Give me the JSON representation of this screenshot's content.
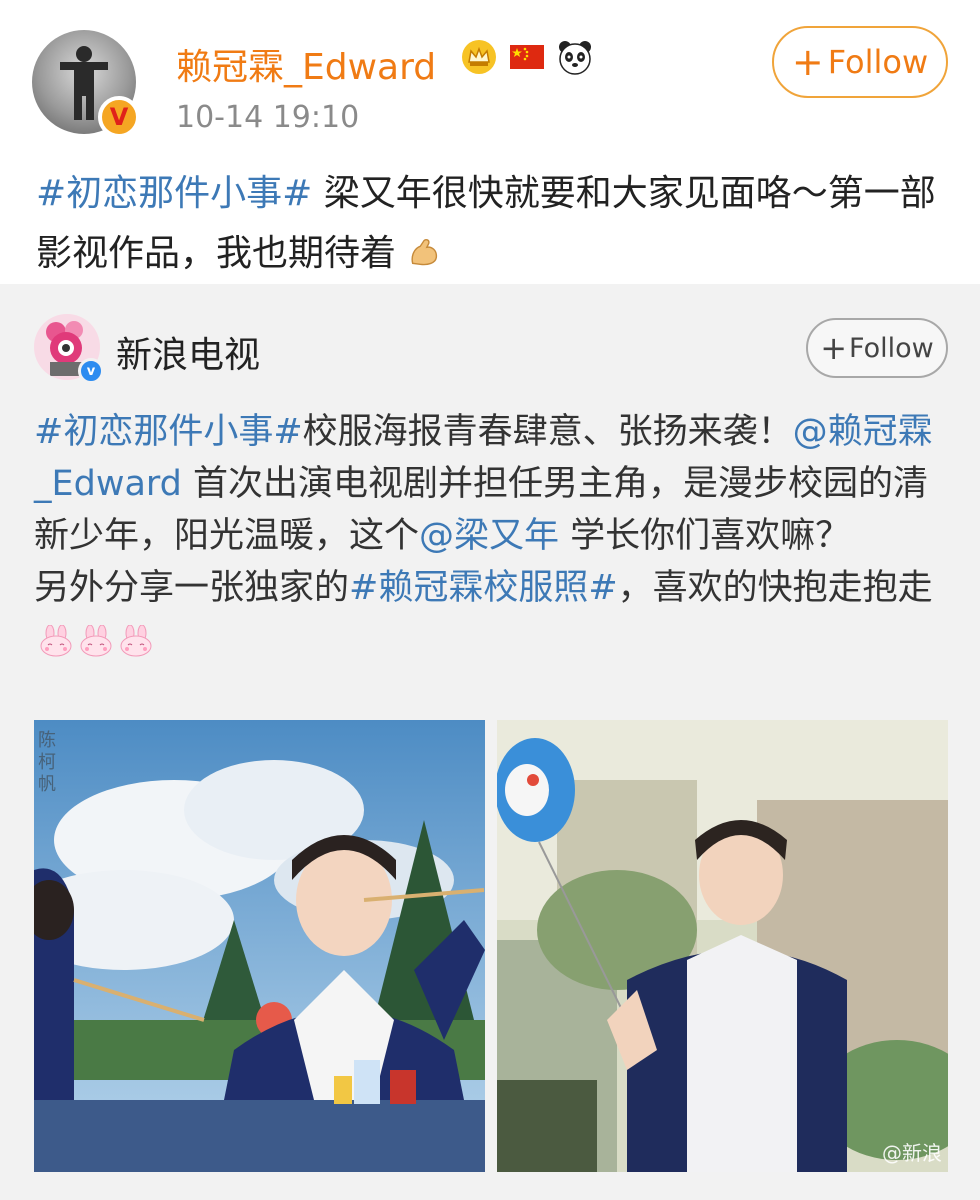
{
  "post": {
    "username": "赖冠霖_Edward",
    "timestamp": "10-14 19:10",
    "follow_label": "Follow",
    "follow_plus": "+",
    "verified_mark": "V",
    "badges": [
      "crown-badge-icon",
      "china-flag-icon",
      "panda-icon"
    ],
    "text_parts": [
      {
        "type": "hashtag",
        "text": "#初恋那件小事#"
      },
      {
        "type": "text",
        "text": " 梁又年很快就要和大家见面咯～第一部影视作品，我也期待着"
      }
    ],
    "emoji": "flexed-bicep-icon"
  },
  "repost": {
    "name": "新浪电视",
    "follow_label": "Follow",
    "follow_plus": "+",
    "verified_mark": "v",
    "text_parts": [
      {
        "type": "hashtag",
        "text": "#初恋那件小事#"
      },
      {
        "type": "text",
        "text": "校服海报青春肆意、张扬来袭！"
      },
      {
        "type": "mention",
        "text": "@赖冠霖_Edward"
      },
      {
        "type": "text",
        "text": " 首次出演电视剧并担任男主角，是漫步校园的清新少年，阳光温暖，这个"
      },
      {
        "type": "mention",
        "text": "@梁又年"
      },
      {
        "type": "text",
        "text": " 学长你们喜欢嘛？"
      }
    ],
    "text_parts_2": [
      {
        "type": "text",
        "text": "另外分享一张独家的"
      },
      {
        "type": "hashtag",
        "text": "#赖冠霖校服照#"
      },
      {
        "type": "text",
        "text": "，喜欢的快抱走抱走"
      }
    ],
    "emoji": [
      "bunny-icon",
      "bunny-icon",
      "bunny-icon"
    ],
    "photos": [
      {
        "name": "poster-photo",
        "side_text": "陈柯帆"
      },
      {
        "name": "uniform-photo",
        "watermark": "@新浪"
      }
    ]
  },
  "colors": {
    "username": "#f07b14",
    "follow_border": "#f0a43a",
    "link": "#3d79b6",
    "timestamp": "#8a8a8a",
    "repost_bg": "#f2f2f2"
  }
}
